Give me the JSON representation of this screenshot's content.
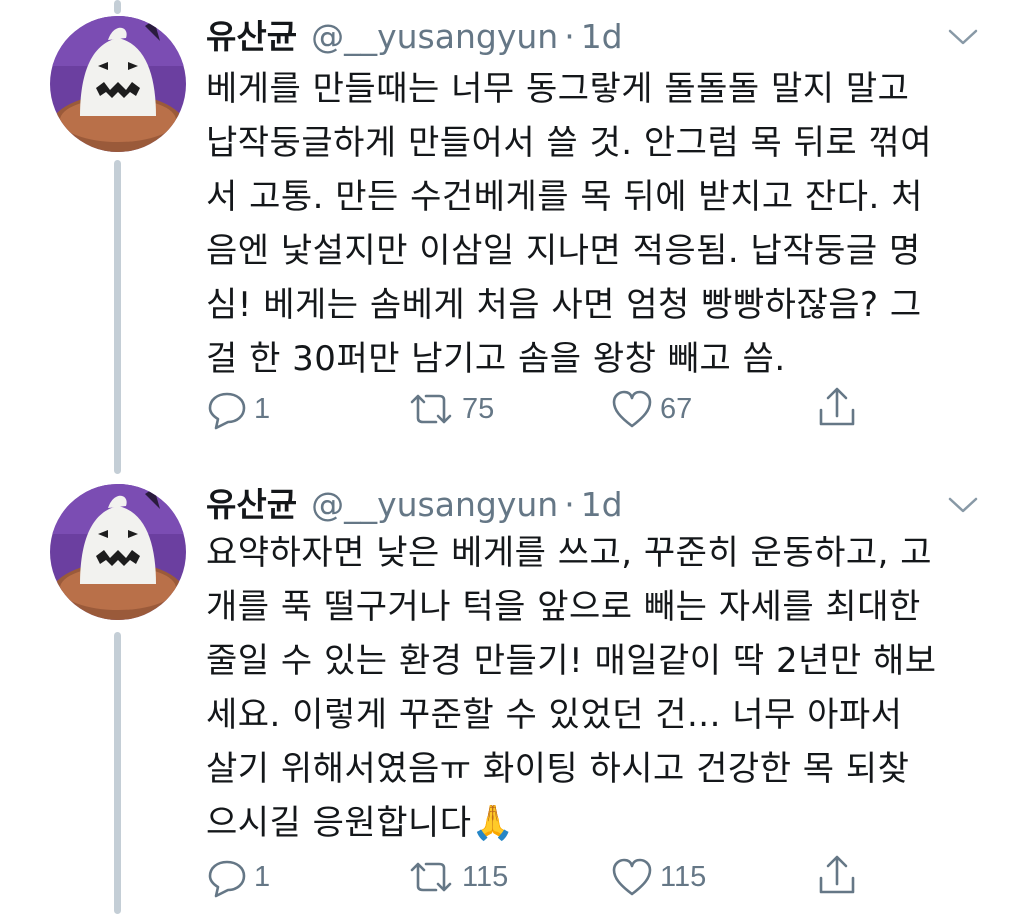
{
  "tweets": [
    {
      "name": "유산균",
      "handle": "@__yusangyun",
      "separator": "·",
      "time": "1d",
      "text": "베게를 만들때는 너무 동그랗게 돌돌돌 말지 말고\n납작둥글하게 만들어서 쓸 것. 안그럼 목 뒤로 꺾여\n서 고통. 만든 수건베게를 목 뒤에 받치고 잔다. 처\n음엔 낯설지만 이삼일 지나면 적응됨. 납작둥글 명\n심! 베게는 솜베게 처음 사면 엄청 빵빵하잖음? 그\n걸 한 30퍼만 남기고 솜을 왕창 빼고 씀.",
      "replies": "1",
      "retweets": "75",
      "likes": "67"
    },
    {
      "name": "유산균",
      "handle": "@__yusangyun",
      "separator": "·",
      "time": "1d",
      "text": "요약하자면 낮은 베게를 쓰고, 꾸준히 운동하고, 고\n개를 푹 떨구거나 턱을 앞으로 빼는 자세를 최대한\n줄일 수 있는 환경 만들기! 매일같이 딱 2년만 해보\n세요. 이렇게 꾸준할 수 있었던 건... 너무 아파서\n살기 위해서였음ㅠ 화이팅 하시고 건강한 목 되찾\n으시길 응원합니다🙏",
      "replies": "1",
      "retweets": "115",
      "likes": "115"
    }
  ],
  "icons": {
    "reply": "reply-icon",
    "retweet": "retweet-icon",
    "like": "like-icon",
    "share": "share-icon",
    "caret": "chevron-down-icon"
  },
  "colors": {
    "text": "#14171a",
    "muted": "#657786",
    "thread_line": "#c4ced6",
    "avatar_bg": "#6b3fa0"
  }
}
